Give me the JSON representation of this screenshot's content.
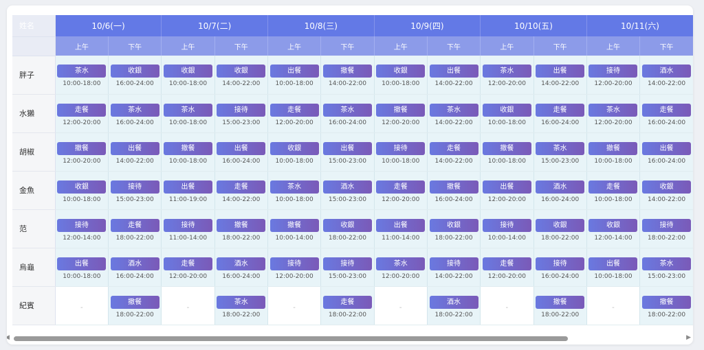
{
  "header": {
    "name_label": "姓名",
    "half_labels": [
      "上午",
      "下午"
    ],
    "dates": [
      "10/6(一)",
      "10/7(二)",
      "10/8(三)",
      "10/9(四)",
      "10/10(五)",
      "10/11(六)"
    ]
  },
  "empty_text": "-",
  "rows": [
    {
      "name": "胖子",
      "slots": [
        {
          "role": "茶水",
          "time": "10:00-18:00"
        },
        {
          "role": "收銀",
          "time": "16:00-24:00"
        },
        {
          "role": "收銀",
          "time": "10:00-18:00"
        },
        {
          "role": "收銀",
          "time": "14:00-22:00"
        },
        {
          "role": "出餐",
          "time": "10:00-18:00"
        },
        {
          "role": "撤餐",
          "time": "14:00-22:00"
        },
        {
          "role": "收銀",
          "time": "10:00-18:00"
        },
        {
          "role": "出餐",
          "time": "14:00-22:00"
        },
        {
          "role": "茶水",
          "time": "12:00-20:00"
        },
        {
          "role": "出餐",
          "time": "14:00-22:00"
        },
        {
          "role": "接待",
          "time": "12:00-20:00"
        },
        {
          "role": "酒水",
          "time": "14:00-22:00"
        }
      ]
    },
    {
      "name": "水獺",
      "slots": [
        {
          "role": "走餐",
          "time": "12:00-20:00"
        },
        {
          "role": "茶水",
          "time": "16:00-24:00"
        },
        {
          "role": "茶水",
          "time": "10:00-18:00"
        },
        {
          "role": "接待",
          "time": "15:00-23:00"
        },
        {
          "role": "走餐",
          "time": "12:00-20:00"
        },
        {
          "role": "茶水",
          "time": "16:00-24:00"
        },
        {
          "role": "撤餐",
          "time": "12:00-20:00"
        },
        {
          "role": "茶水",
          "time": "14:00-22:00"
        },
        {
          "role": "收銀",
          "time": "10:00-18:00"
        },
        {
          "role": "走餐",
          "time": "16:00-24:00"
        },
        {
          "role": "茶水",
          "time": "12:00-20:00"
        },
        {
          "role": "走餐",
          "time": "16:00-24:00"
        }
      ]
    },
    {
      "name": "胡椒",
      "slots": [
        {
          "role": "撤餐",
          "time": "12:00-20:00"
        },
        {
          "role": "出餐",
          "time": "14:00-22:00"
        },
        {
          "role": "撤餐",
          "time": "10:00-18:00"
        },
        {
          "role": "出餐",
          "time": "16:00-24:00"
        },
        {
          "role": "收銀",
          "time": "10:00-18:00"
        },
        {
          "role": "出餐",
          "time": "15:00-23:00"
        },
        {
          "role": "接待",
          "time": "10:00-18:00"
        },
        {
          "role": "走餐",
          "time": "14:00-22:00"
        },
        {
          "role": "撤餐",
          "time": "10:00-18:00"
        },
        {
          "role": "茶水",
          "time": "15:00-23:00"
        },
        {
          "role": "撤餐",
          "time": "10:00-18:00"
        },
        {
          "role": "出餐",
          "time": "16:00-24:00"
        }
      ]
    },
    {
      "name": "金魚",
      "slots": [
        {
          "role": "收銀",
          "time": "10:00-18:00"
        },
        {
          "role": "接待",
          "time": "15:00-23:00"
        },
        {
          "role": "出餐",
          "time": "11:00-19:00"
        },
        {
          "role": "走餐",
          "time": "14:00-22:00"
        },
        {
          "role": "茶水",
          "time": "10:00-18:00"
        },
        {
          "role": "酒水",
          "time": "15:00-23:00"
        },
        {
          "role": "走餐",
          "time": "12:00-20:00"
        },
        {
          "role": "撤餐",
          "time": "16:00-24:00"
        },
        {
          "role": "出餐",
          "time": "12:00-20:00"
        },
        {
          "role": "酒水",
          "time": "16:00-24:00"
        },
        {
          "role": "走餐",
          "time": "10:00-18:00"
        },
        {
          "role": "收銀",
          "time": "14:00-22:00"
        }
      ]
    },
    {
      "name": "范",
      "slots": [
        {
          "role": "接待",
          "time": "12:00-14:00"
        },
        {
          "role": "走餐",
          "time": "18:00-22:00"
        },
        {
          "role": "接待",
          "time": "11:00-14:00"
        },
        {
          "role": "撤餐",
          "time": "18:00-22:00"
        },
        {
          "role": "撤餐",
          "time": "10:00-14:00"
        },
        {
          "role": "收銀",
          "time": "18:00-22:00"
        },
        {
          "role": "出餐",
          "time": "11:00-14:00"
        },
        {
          "role": "收銀",
          "time": "18:00-22:00"
        },
        {
          "role": "接待",
          "time": "10:00-14:00"
        },
        {
          "role": "收銀",
          "time": "18:00-22:00"
        },
        {
          "role": "收銀",
          "time": "12:00-14:00"
        },
        {
          "role": "接待",
          "time": "18:00-22:00"
        }
      ]
    },
    {
      "name": "烏龜",
      "slots": [
        {
          "role": "出餐",
          "time": "10:00-18:00"
        },
        {
          "role": "酒水",
          "time": "16:00-24:00"
        },
        {
          "role": "走餐",
          "time": "12:00-20:00"
        },
        {
          "role": "酒水",
          "time": "16:00-24:00"
        },
        {
          "role": "接待",
          "time": "12:00-20:00"
        },
        {
          "role": "接待",
          "time": "15:00-23:00"
        },
        {
          "role": "茶水",
          "time": "12:00-20:00"
        },
        {
          "role": "接待",
          "time": "14:00-22:00"
        },
        {
          "role": "走餐",
          "time": "12:00-20:00"
        },
        {
          "role": "接待",
          "time": "16:00-24:00"
        },
        {
          "role": "出餐",
          "time": "10:00-18:00"
        },
        {
          "role": "茶水",
          "time": "15:00-23:00"
        }
      ]
    },
    {
      "name": "紀賓",
      "slots": [
        null,
        {
          "role": "撤餐",
          "time": "18:00-22:00"
        },
        null,
        {
          "role": "茶水",
          "time": "18:00-22:00"
        },
        null,
        {
          "role": "走餐",
          "time": "18:00-22:00"
        },
        null,
        {
          "role": "酒水",
          "time": "18:00-22:00"
        },
        null,
        {
          "role": "撤餐",
          "time": "18:00-22:00"
        },
        null,
        {
          "role": "撤餐",
          "time": "18:00-22:00"
        }
      ]
    }
  ],
  "scroll": {
    "left_icon": "arrow-left-icon",
    "right_icon": "arrow-right-icon",
    "position": 0.0
  }
}
